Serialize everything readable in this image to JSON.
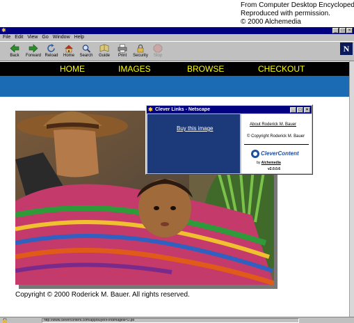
{
  "credit": {
    "line1": "From Computer Desktop Encyclopedia",
    "line2": "Reproduced with permission.",
    "line3": "© 2000 Alchemedia"
  },
  "browser": {
    "menu": [
      "File",
      "Edit",
      "View",
      "Go",
      "Window",
      "Help"
    ],
    "toolbar": [
      {
        "label": "Back",
        "icon": "back-arrow-icon"
      },
      {
        "label": "Forward",
        "icon": "forward-arrow-icon"
      },
      {
        "label": "Reload",
        "icon": "reload-icon"
      },
      {
        "label": "Home",
        "icon": "home-icon"
      },
      {
        "label": "Search",
        "icon": "search-icon"
      },
      {
        "label": "Guide",
        "icon": "guide-icon"
      },
      {
        "label": "Print",
        "icon": "print-icon"
      },
      {
        "label": "Security",
        "icon": "security-icon"
      },
      {
        "label": "Stop",
        "icon": "stop-icon"
      }
    ],
    "logo_letter": "N",
    "status_url": "http://www.clevercontent.com/app/buyer/FindImagesPO.po"
  },
  "site": {
    "nav": [
      "HOME",
      "IMAGES",
      "BROWSE",
      "CHECKOUT"
    ],
    "nav_color": "#ffff00",
    "band_color": "#1a6ab4",
    "copyright": "Copyright © 2000 Roderick M. Bauer. All rights reserved."
  },
  "popup": {
    "title": "Clever Links - Netscape",
    "buy_link": "Buy this image",
    "about_link": "About Roderick M. Bauer",
    "copyright": "© Copyright Roderick M. Bauer",
    "logo_name": "CleverContent",
    "by_prefix": "by",
    "by_name": "Alchemedia",
    "version": "v2.0.0.6"
  }
}
